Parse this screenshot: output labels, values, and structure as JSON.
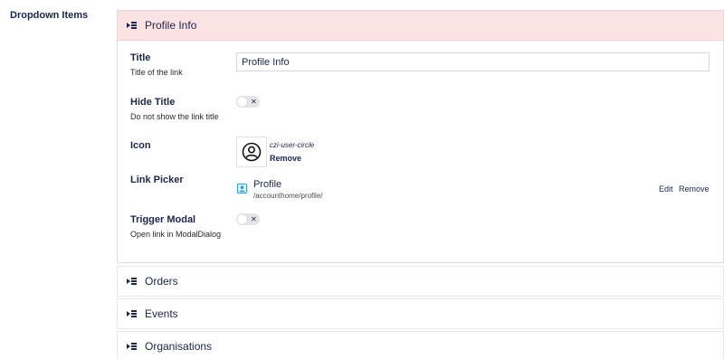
{
  "property": {
    "label": "Dropdown Items"
  },
  "blocks": [
    {
      "title": "Profile Info",
      "fields": {
        "title": {
          "label": "Title",
          "description": "Title of the link",
          "value": "Profile Info"
        },
        "hide_title": {
          "label": "Hide Title",
          "description": "Do not show the link title",
          "toggle_symbol": "✕"
        },
        "icon": {
          "label": "Icon",
          "name": "czi-user-circle",
          "remove_label": "Remove"
        },
        "link_picker": {
          "label": "Link Picker",
          "name": "Profile",
          "url": "/accounthome/profile/",
          "edit_label": "Edit",
          "remove_label": "Remove"
        },
        "trigger_modal": {
          "label": "Trigger Modal",
          "description": "Open link in ModalDialog",
          "toggle_symbol": "✕"
        }
      }
    },
    {
      "title": "Orders"
    },
    {
      "title": "Events"
    },
    {
      "title": "Organisations"
    }
  ],
  "colors": {
    "active_header": "#fbe3e3",
    "text": "#1b264f",
    "link_icon": "#2b9be0"
  }
}
